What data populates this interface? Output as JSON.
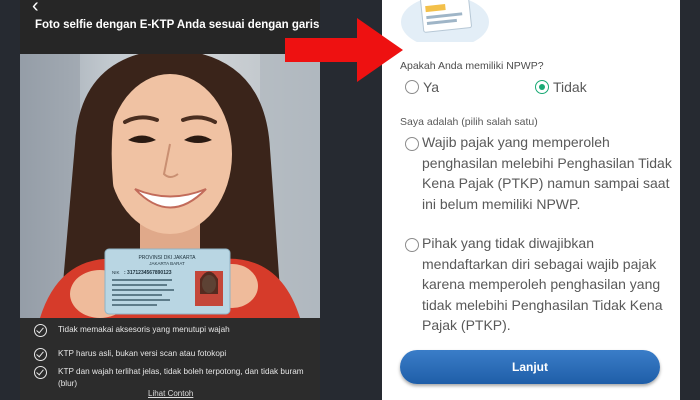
{
  "selfie_screen": {
    "back_icon": "chevron-left-icon",
    "title": "Foto selfie dengan E-KTP Anda sesuai dengan garis bantu",
    "ktp_card": {
      "province": "PROVINSI DKI JAKARTA",
      "city": "JAKARTA BARAT",
      "nik_label": "NIK",
      "nik": ": 3171234567890123"
    },
    "checklist": [
      "Tidak memakai aksesoris yang menutupi wajah",
      "KTP harus asli, bukan versi scan atau fotokopi",
      "KTP dan wajah terlihat jelas, tidak boleh terpotong, dan tidak buram (blur)"
    ],
    "see_example_link": "Lihat Contoh"
  },
  "npwp_form": {
    "question": "Apakah Anda memiliki NPWP?",
    "answers": [
      {
        "label": "Ya",
        "selected": false
      },
      {
        "label": "Tidak",
        "selected": true
      }
    ],
    "status_label": "Saya adalah (pilih salah satu)",
    "status_options": [
      {
        "text": "Wajib pajak yang memperoleh penghasilan melebihi Penghasilan Tidak Kena Pajak (PTKP) namun sampai saat ini belum memiliki NPWP.",
        "selected": false
      },
      {
        "text": "Pihak yang tidak diwajibkan mendaftarkan diri sebagai wajib pajak karena memperoleh penghasilan yang tidak melebihi Penghasilan Tidak Kena Pajak (PTKP).",
        "selected": false
      }
    ],
    "next_button": "Lanjut"
  },
  "colors": {
    "selected_radio": "#19a974",
    "button": "#2b6cb8",
    "arrow": "#ee1111",
    "dark_panel": "#2c2c2c"
  }
}
